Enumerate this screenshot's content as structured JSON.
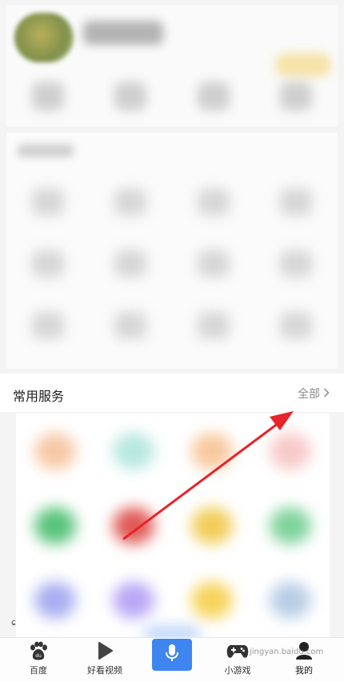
{
  "services": {
    "title": "常用服务",
    "all_label": "全部",
    "items": [
      {
        "color": "#f7c8a6"
      },
      {
        "color": "#b6e8e0"
      },
      {
        "color": "#f8c99e"
      },
      {
        "color": "#f7c9c9"
      },
      {
        "color": "#58c47a"
      },
      {
        "color": "#e05a57"
      },
      {
        "color": "#f1cd58"
      },
      {
        "color": "#7fd39c"
      },
      {
        "color": "#a9aef0"
      },
      {
        "color": "#b8a8f5"
      },
      {
        "color": "#f7d35a"
      },
      {
        "color": "#b9cde6"
      }
    ]
  },
  "bottom_nav": {
    "items": [
      {
        "label": "百度",
        "icon": "baidu-paw-icon"
      },
      {
        "label": "好看视频",
        "icon": "play-icon"
      },
      {
        "label": "小游戏",
        "icon": "gamepad-icon"
      },
      {
        "label": "我的",
        "icon": "user-icon"
      }
    ],
    "mic_icon": "microphone-icon"
  },
  "watermark": "jingyan.baidu.com",
  "accent_color": "#3e85f0",
  "annotation_color": "#e8232a"
}
